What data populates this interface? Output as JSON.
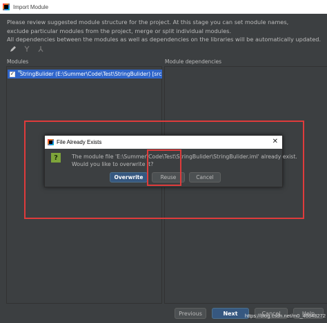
{
  "window": {
    "title": "Import Module"
  },
  "description": {
    "lines": [
      "Please review suggested module structure for the project. At this stage you can set module names,",
      "exclude particular modules from the project, merge or split individual modules.",
      "All dependencies between the modules as well as dependencies on the libraries will be automatically updated."
    ]
  },
  "toolbar": {
    "icons": [
      "edit-icon",
      "merge-icon",
      "split-icon"
    ]
  },
  "panels": {
    "modules_label": "Modules",
    "dependencies_label": "Module dependencies"
  },
  "modules": [
    {
      "name": "StringBulider (E:\\Summer\\Code\\Test\\StringBulider) [src]",
      "checked": true
    }
  ],
  "dialog": {
    "title": "File Already Exists",
    "close_glyph": "✕",
    "message_line1": "The module file 'E:\\Summer\\Code\\Test\\StringBulider\\StringBulider.iml' already exist.",
    "message_line2": "Would you like to overwrite it?",
    "buttons": {
      "overwrite": "Overwrite",
      "reuse": "Reuse",
      "cancel": "Cancel"
    }
  },
  "bottom_buttons": {
    "previous": "Previous",
    "next": "Next",
    "cancel": "Cancel",
    "help": "Help"
  },
  "watermark": "https://blog.csdn.net/m0_46848272",
  "colors": {
    "accent": "#365880",
    "selection": "#2f65ca",
    "annotation": "#e03b3b",
    "background": "#3c3f41"
  }
}
